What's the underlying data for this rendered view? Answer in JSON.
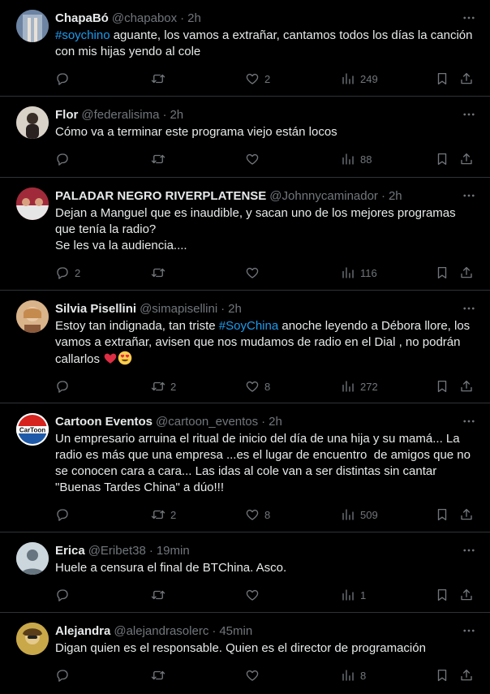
{
  "tweets": [
    {
      "name": "ChapaBó",
      "handle": "@chapabox",
      "time": "2h",
      "hashtag": "#soychino",
      "text_after": " aguante, los vamos a extrañar, cantamos todos los días la canción con mis hijas yendo al cole",
      "replies": "",
      "retweets": "",
      "likes": "2",
      "views": "249",
      "avatar_color": "#5a6f8a"
    },
    {
      "name": "Flor",
      "handle": "@federalisima",
      "time": "2h",
      "text": "Cómo va a terminar este programa viejo están locos",
      "replies": "",
      "retweets": "",
      "likes": "",
      "views": "88",
      "avatar_color": "#8a7866"
    },
    {
      "name": "PALADAR NEGRO RIVERPLATENSE",
      "handle": "@Johnnycaminador",
      "time": "2h",
      "text": "Dejan a Manguel que es inaudible, y sacan uno de los mejores programas que tenía la radio?\nSe les va la audiencia....",
      "replies": "2",
      "retweets": "",
      "likes": "",
      "views": "116",
      "avatar_color": "#b03040"
    },
    {
      "name": "Silvia Pisellini",
      "handle": "@simapisellini",
      "time": "2h",
      "text_before": "Estoy tan indignada, tan triste ",
      "hashtag": "#SoyChina",
      "text_after": " anoche leyendo a Débora llore, los vamos a extrañar, avisen que nos mudamos de radio en el Dial , no podrán callarlos ",
      "replies": "",
      "retweets": "2",
      "likes": "8",
      "views": "272",
      "avatar_color": "#c49a6c"
    },
    {
      "name": "Cartoon Eventos",
      "handle": "@cartoon_eventos",
      "time": "2h",
      "text": "Un empresario arruina el ritual de inicio del día de una hija y su mamá... La radio es más que una empresa ...es el lugar de encuentro  de amigos que no se conocen cara a cara... Las idas al cole van a ser distintas sin cantar \"Buenas Tardes China\" a dúo!!!",
      "avatar_label": "CarToon",
      "replies": "",
      "retweets": "2",
      "likes": "8",
      "views": "509",
      "avatar_color": "#ffffff"
    },
    {
      "name": "Erica",
      "handle": "@Eribet38",
      "time": "19min",
      "text": "Huele a censura el final de BTChina. Asco.",
      "replies": "",
      "retweets": "",
      "likes": "",
      "views": "1",
      "avatar_color": "#ccd6dd"
    },
    {
      "name": "Alejandra",
      "handle": "@alejandrasolerc",
      "time": "45min",
      "text": "Digan quien es el responsable. Quien es el director de programación",
      "replies": "",
      "retweets": "",
      "likes": "",
      "views": "8",
      "avatar_color": "#b89a3a"
    }
  ],
  "icons": {
    "reply": "reply-icon",
    "retweet": "retweet-icon",
    "like": "like-icon",
    "views": "views-icon",
    "bookmark": "bookmark-icon",
    "share": "share-icon",
    "more": "more-icon"
  },
  "colors": {
    "background": "#000000",
    "text": "#e7e9ea",
    "muted": "#71767b",
    "link": "#1d9bf0",
    "divider": "#2f3336"
  }
}
